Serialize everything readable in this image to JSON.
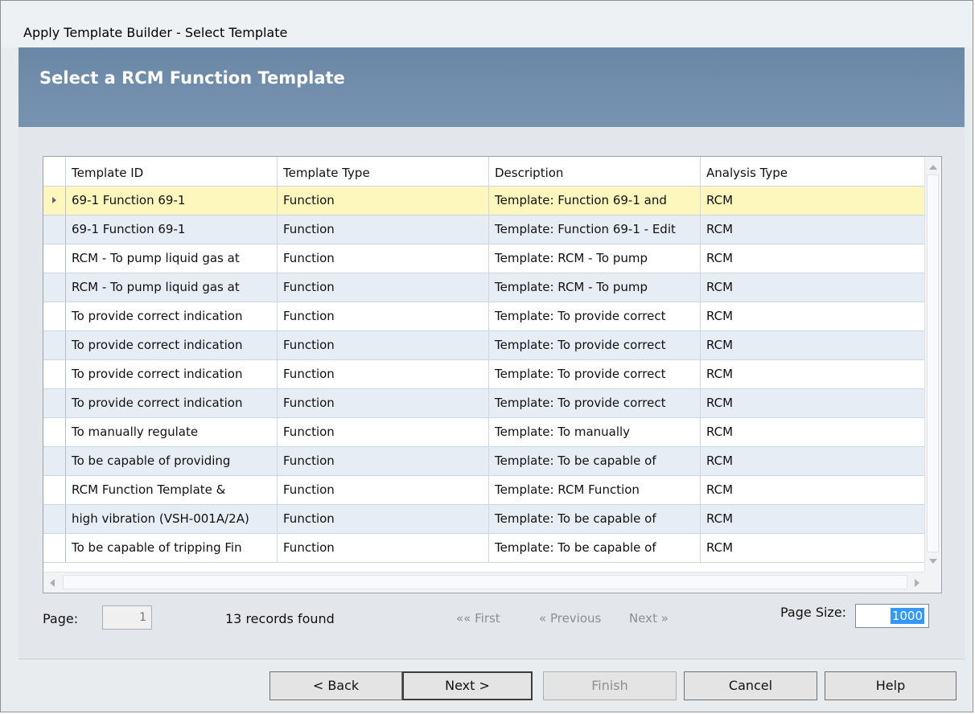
{
  "window": {
    "title": "Apply Template Builder - Select Template"
  },
  "banner": {
    "heading": "Select a RCM Function Template"
  },
  "grid": {
    "columns": [
      "Template ID",
      "Template Type",
      "Description",
      "Analysis Type"
    ],
    "rows": [
      [
        "69-1 Function 69-1",
        "Function",
        "Template: Function 69-1 and",
        "RCM"
      ],
      [
        "69-1 Function 69-1",
        "Function",
        "Template: Function 69-1 - Edit",
        "RCM"
      ],
      [
        "RCM -  To pump liquid gas at",
        "Function",
        "Template: RCM -  To pump",
        "RCM"
      ],
      [
        "RCM -  To pump liquid gas at",
        "Function",
        "Template: RCM -  To pump",
        "RCM"
      ],
      [
        "To provide correct indication",
        "Function",
        "Template: To provide correct",
        "RCM"
      ],
      [
        "To provide correct indication",
        "Function",
        "Template: To provide correct",
        "RCM"
      ],
      [
        "To provide correct indication",
        "Function",
        "Template: To provide correct",
        "RCM"
      ],
      [
        "To provide correct indication",
        "Function",
        "Template: To provide correct",
        "RCM"
      ],
      [
        "To manually regulate",
        "Function",
        "Template: To manually",
        "RCM"
      ],
      [
        "To be capable of providing",
        "Function",
        "Template: To be capable of",
        "RCM"
      ],
      [
        "RCM Function Template &",
        "Function",
        "Template: RCM Function",
        "RCM"
      ],
      [
        "high vibration (VSH-001A/2A)",
        "Function",
        "Template: To be capable of",
        "RCM"
      ],
      [
        "To be capable of tripping Fin",
        "Function",
        "Template: To be capable of",
        "RCM"
      ]
    ],
    "selected_row": 0
  },
  "pager": {
    "page_label": "Page:",
    "page_value": "1",
    "records_text": "13 records found",
    "first_label": "«« First",
    "previous_label": "« Previous",
    "next_label": "Next »",
    "page_size_label": "Page Size:",
    "page_size_value": "1000"
  },
  "buttons": {
    "back": "< Back",
    "next": "Next >",
    "finish": "Finish",
    "cancel": "Cancel",
    "help": "Help"
  },
  "colors": {
    "banner": "#6a87a6",
    "selected_row": "#fdf6bd",
    "alt_row": "#e7edf5",
    "selection_highlight": "#3399ff"
  }
}
